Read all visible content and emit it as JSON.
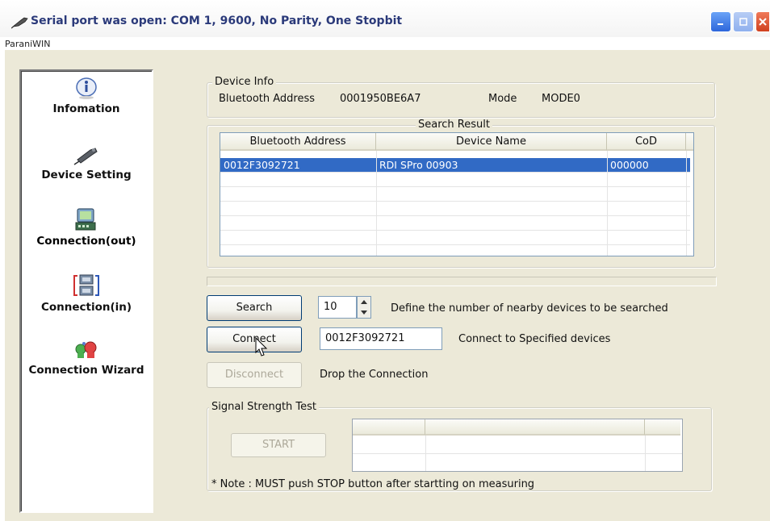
{
  "window": {
    "title": "Serial port was open: COM 1, 9600, No Parity, One Stopbit",
    "app_name": "ParaniWIN"
  },
  "nav": {
    "items": [
      {
        "label": "Infomation",
        "icon": "info-icon"
      },
      {
        "label": "Device Setting",
        "icon": "device-setting-icon"
      },
      {
        "label": "Connection(out)",
        "icon": "connection-out-icon",
        "active": true
      },
      {
        "label": "Connection(in)",
        "icon": "connection-in-icon"
      },
      {
        "label": "Connection Wizard",
        "icon": "connection-wizard-icon"
      }
    ]
  },
  "device_info": {
    "legend": "Device Info",
    "bt_address_label": "Bluetooth Address",
    "bt_address_value": "0001950BE6A7",
    "mode_label": "Mode",
    "mode_value": "MODE0"
  },
  "search_result": {
    "legend": "Search Result",
    "columns": [
      "Bluetooth Address",
      "Device Name",
      "CoD"
    ],
    "rows": [
      {
        "address": "0012F3092721",
        "name": "RDI SPro 00903",
        "cod": "000000",
        "selected": true
      }
    ]
  },
  "controls": {
    "search_label": "Search",
    "search_count": "10",
    "search_desc": "Define the number of nearby devices to be searched",
    "connect_label": "Connect",
    "connect_address": "0012F3092721",
    "connect_desc": "Connect to Specified devices",
    "disconnect_label": "Disconnect",
    "disconnect_desc": "Drop the Connection"
  },
  "signal": {
    "legend": "Signal Strength Test",
    "start_label": "START",
    "note": "* Note : MUST push STOP button after startting on measuring"
  },
  "colors": {
    "selection": "#316ac5",
    "window_bg": "#ece9d8",
    "title_text": "#2b3a7a"
  }
}
